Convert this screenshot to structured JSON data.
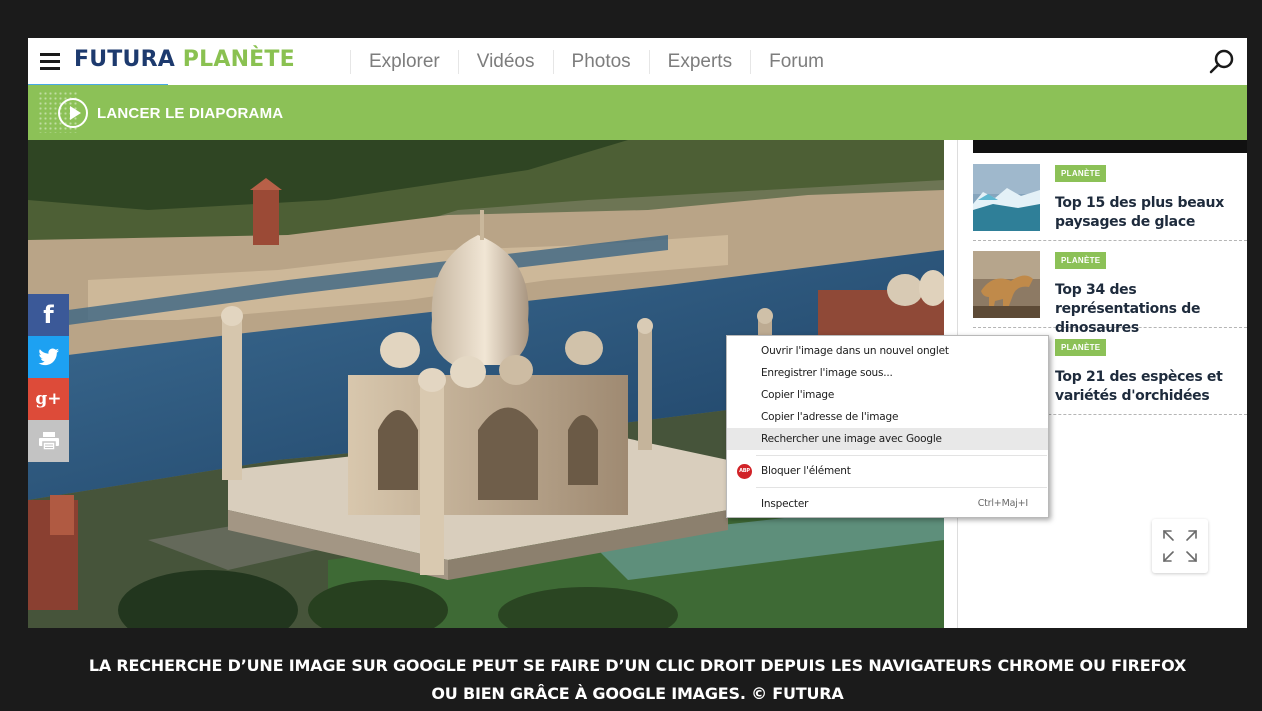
{
  "header": {
    "menu_icon": "hamburger-menu-icon",
    "logo_part1": "FUTURA",
    "logo_part2": "PLANÈTE",
    "nav": [
      {
        "label": "Explorer"
      },
      {
        "label": "Vidéos"
      },
      {
        "label": "Photos"
      },
      {
        "label": "Experts"
      },
      {
        "label": "Forum"
      }
    ],
    "search_icon": "search-icon"
  },
  "slideshow": {
    "label": "LANCER LE DIAPORAMA",
    "icon": "play-circle-icon"
  },
  "share": [
    {
      "name": "facebook",
      "glyph": "f"
    },
    {
      "name": "twitter",
      "glyph": ""
    },
    {
      "name": "google-plus",
      "glyph": "g+"
    },
    {
      "name": "print",
      "glyph": ""
    }
  ],
  "sidebar": {
    "articles": [
      {
        "tag": "PLANÈTE",
        "title": "Top 15 des plus beaux paysages de glace"
      },
      {
        "tag": "PLANÈTE",
        "title": "Top 34 des représentations de dinosaures"
      },
      {
        "tag": "PLANÈTE",
        "title": "Top 21 des espèces et variétés d'orchidées"
      }
    ]
  },
  "context_menu": {
    "items": [
      {
        "label": "Ouvrir l'image dans un nouvel onglet"
      },
      {
        "label": "Enregistrer l'image sous..."
      },
      {
        "label": "Copier l'image"
      },
      {
        "label": "Copier l'adresse de l'image"
      },
      {
        "label": "Rechercher une image avec Google"
      },
      {
        "label": "Bloquer l'élément",
        "icon": "adblock-icon",
        "icon_text": "ABP"
      },
      {
        "label": "Inspecter",
        "shortcut": "Ctrl+Maj+I"
      }
    ],
    "highlighted": "Rechercher une image avec Google"
  },
  "caption": {
    "line1": "LA RECHERCHE D’UNE IMAGE SUR GOOGLE PEUT SE FAIRE D’UN CLIC DROIT DEPUIS LES NAVIGATEURS CHROME OU FIREFOX",
    "line2": "OU BIEN GRÂCE À GOOGLE IMAGES. © FUTURA"
  },
  "colors": {
    "brand_blue": "#1d3a6e",
    "brand_green": "#8cc157",
    "facebook": "#3b5998",
    "twitter": "#1da1f2",
    "google_plus": "#dd4b39"
  }
}
